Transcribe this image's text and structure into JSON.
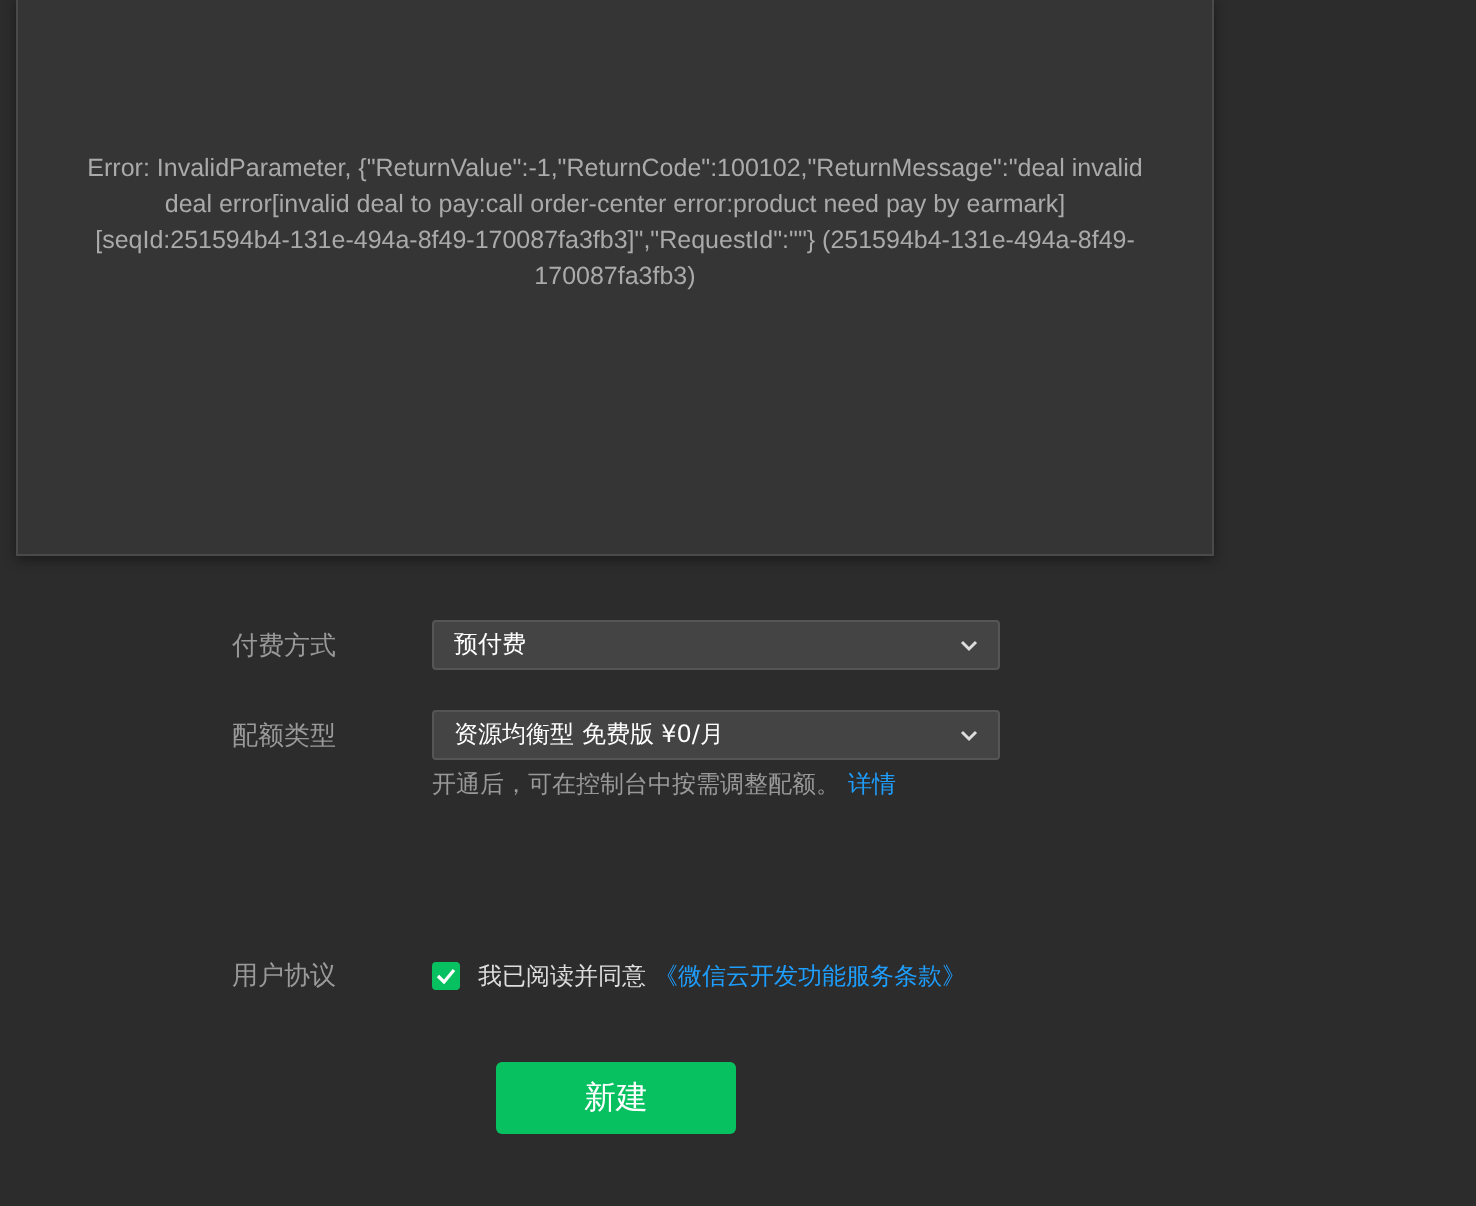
{
  "error_dialog": {
    "message": "Error: InvalidParameter, {\"ReturnValue\":-1,\"ReturnCode\":100102,\"ReturnMessage\":\"deal invalid deal error[invalid deal to pay:call order-center error:product need pay by earmark][seqId:251594b4-131e-494a-8f49-170087fa3fb3]\",\"RequestId\":\"\"} (251594b4-131e-494a-8f49-170087fa3fb3)"
  },
  "payment": {
    "label": "付费方式",
    "value": "预付费"
  },
  "quota": {
    "label": "配额类型",
    "value": "资源均衡型 免费版 ¥0/月",
    "hint": "开通后，可在控制台中按需调整配额。",
    "link": "详情"
  },
  "agreement": {
    "label": "用户协议",
    "checked": true,
    "text": "我已阅读并同意",
    "link": "《微信云开发功能服务条款》"
  },
  "submit": "新建"
}
